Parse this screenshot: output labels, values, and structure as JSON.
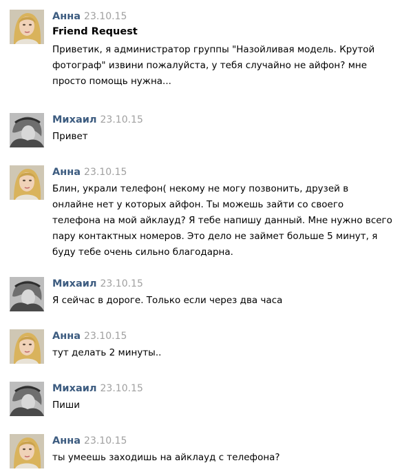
{
  "users": {
    "anna": "Анна",
    "mikhail": "Михаил"
  },
  "icons": {
    "anna_avatar": "avatar-female-blonde",
    "mikhail_avatar": "avatar-male-grayscale"
  },
  "colors": {
    "author": "#3d5c80",
    "date": "#a0a0a0"
  },
  "messages": [
    {
      "author": "Анна",
      "date": "23.10.15",
      "subject": "Friend Request",
      "lines": [
        "Приветик, я администратор группы \"Назойливая модель. Крутой",
        "фотограф\" извини пожалуйста, у тебя случайно не айфон? мне",
        "просто помощь нужна..."
      ]
    },
    {
      "author": "Михаил",
      "date": "23.10.15",
      "lines": [
        "Привет"
      ]
    },
    {
      "author": "Анна",
      "date": "23.10.15",
      "lines": [
        "Блин, украли телефон( некому не могу позвонить, друзей в",
        "онлайне нет у которых айфон. Ты можешь зайти со своего",
        "телефона на мой айклауд? Я тебе напишу данный. Мне нужно всего",
        "пару контактных номеров. Это дело не займет больше 5 минут, я",
        "буду тебе очень сильно благодарна."
      ]
    },
    {
      "author": "Михаил",
      "date": "23.10.15",
      "lines": [
        "Я сейчас в дороге. Только если через два часа"
      ]
    },
    {
      "author": "Анна",
      "date": "23.10.15",
      "lines": [
        "тут делать 2 минуты.."
      ]
    },
    {
      "author": "Михаил",
      "date": "23.10.15",
      "lines": [
        "Пиши"
      ]
    },
    {
      "author": "Анна",
      "date": "23.10.15",
      "lines": [
        "ты умеешь заходишь на айклауд с телефона?"
      ]
    }
  ]
}
